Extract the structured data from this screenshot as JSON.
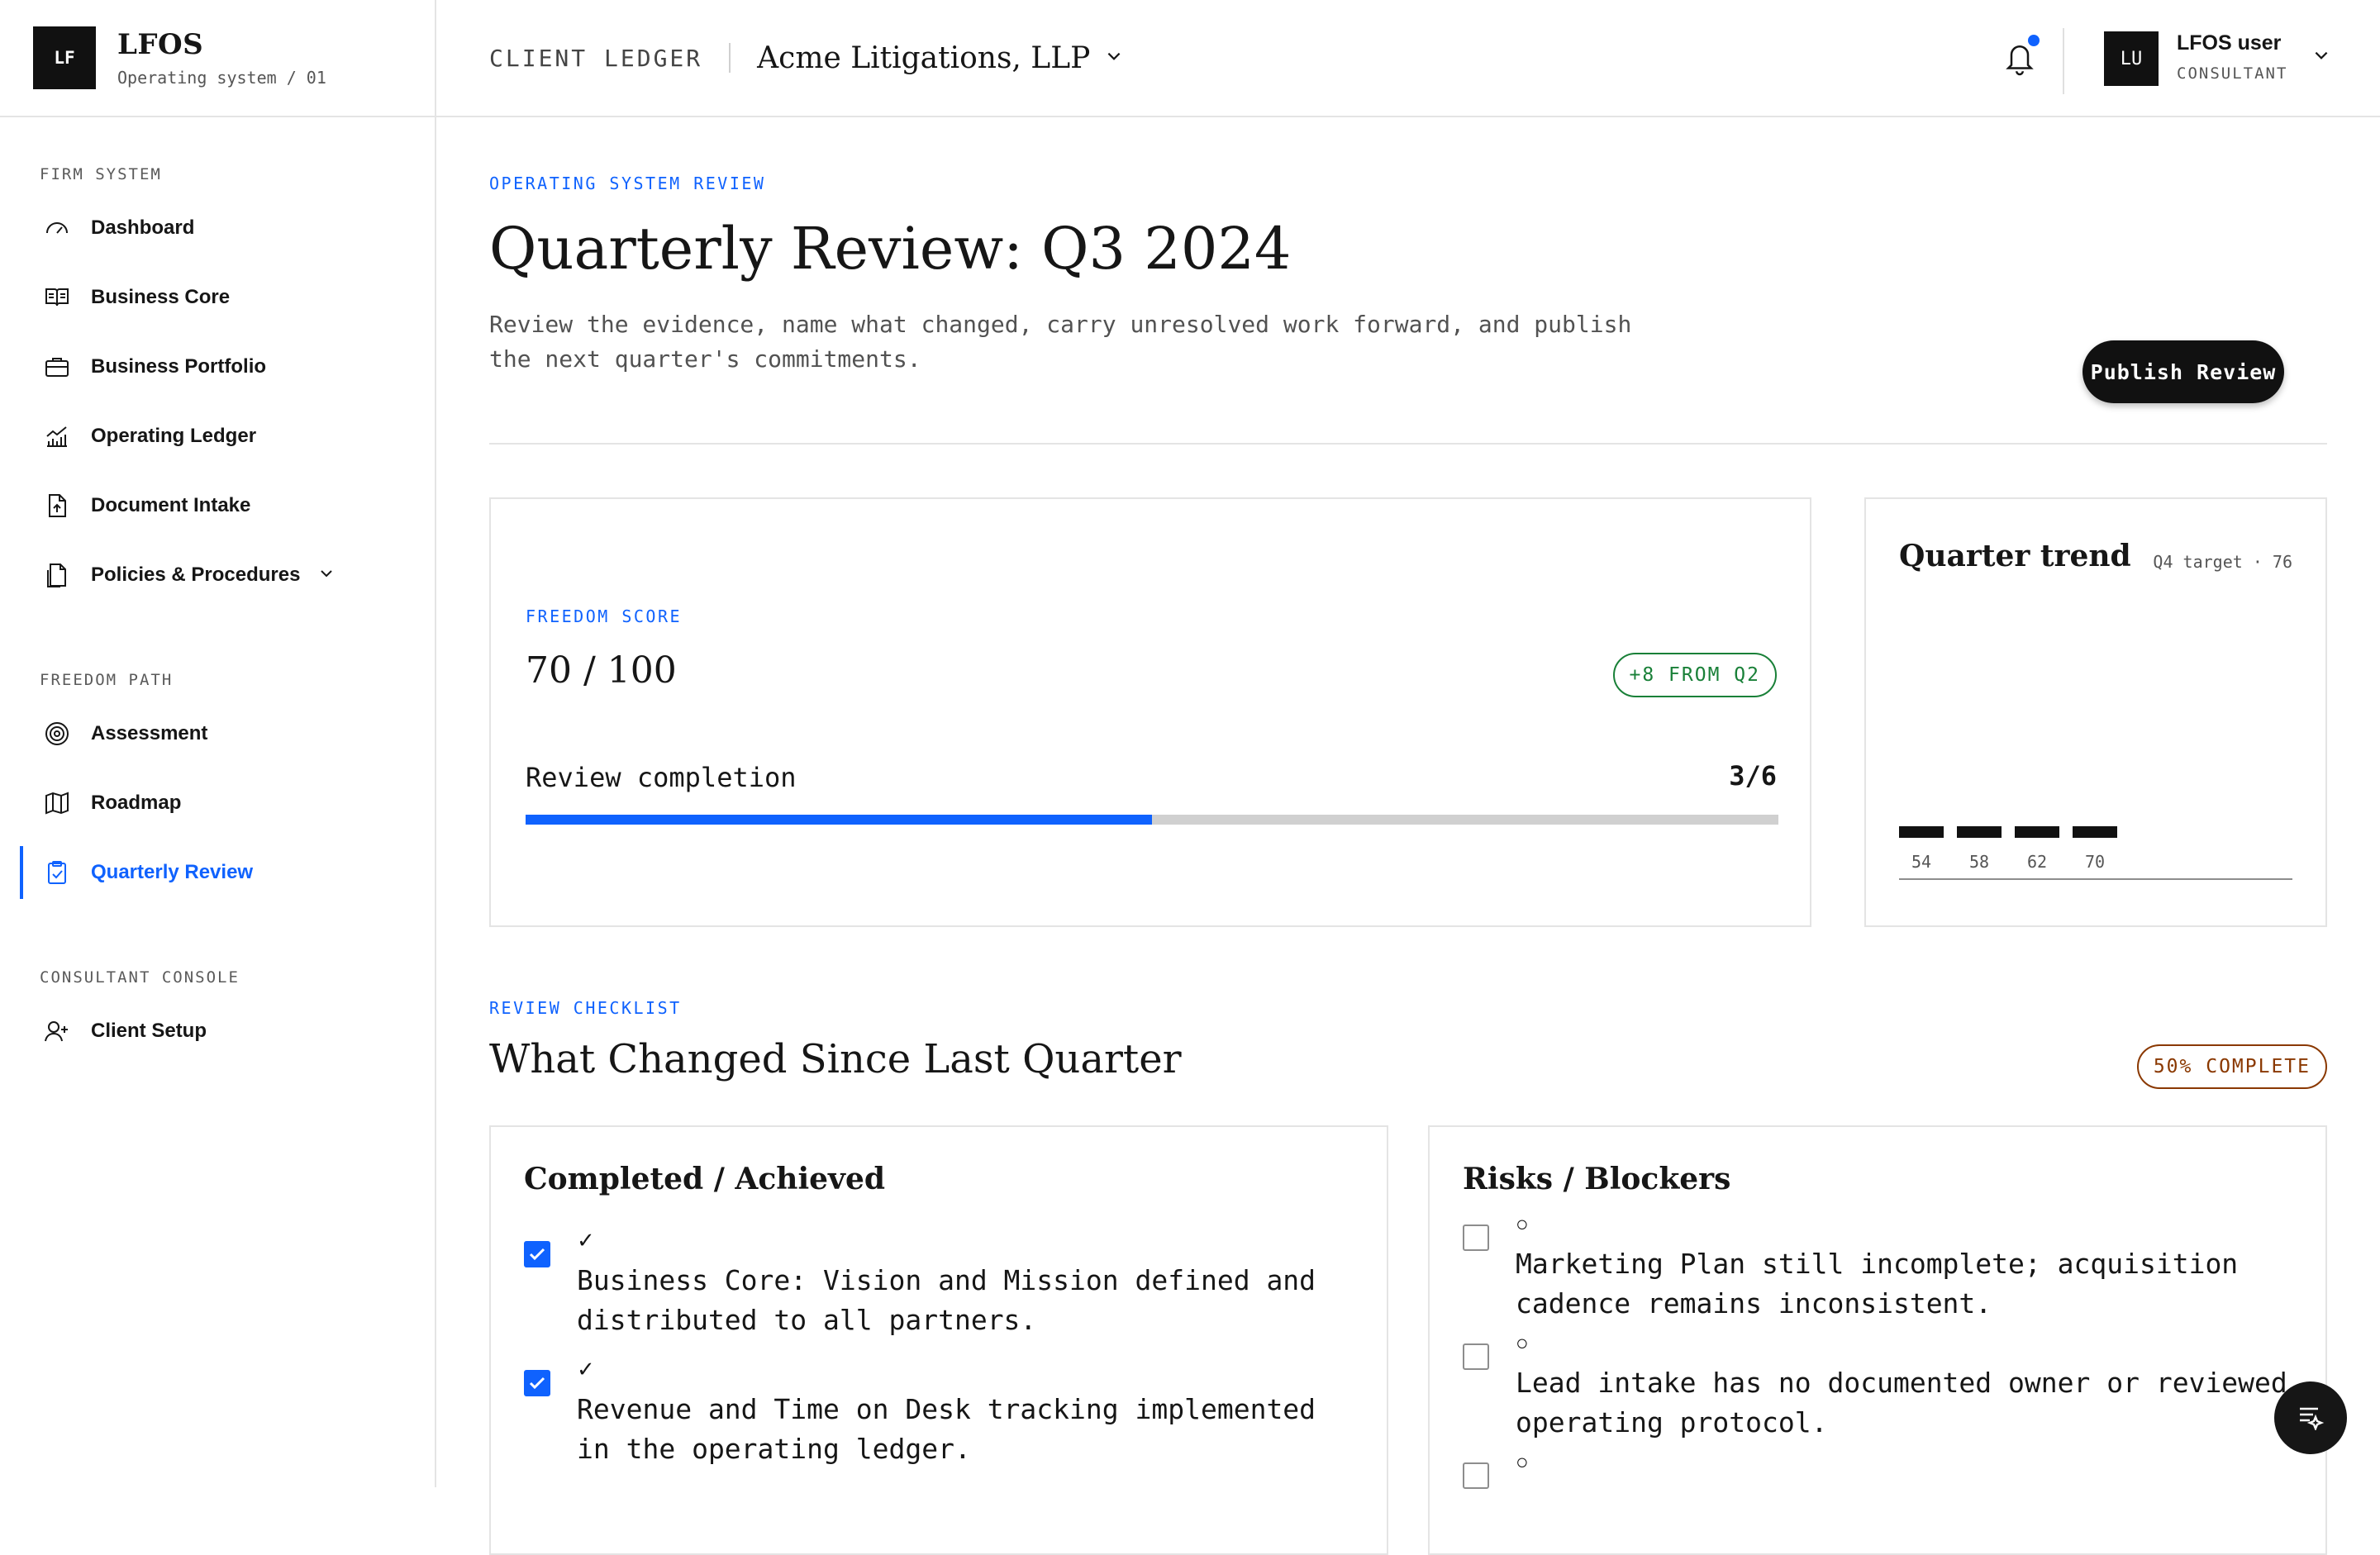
{
  "brand": {
    "mark": "LF",
    "name": "LFOS",
    "subtitle": "Operating system / 01"
  },
  "sidebar": {
    "sections": [
      {
        "title": "FIRM SYSTEM",
        "items": [
          {
            "label": "Dashboard",
            "icon": "gauge-icon"
          },
          {
            "label": "Business Core",
            "icon": "book-icon"
          },
          {
            "label": "Business Portfolio",
            "icon": "briefcase-icon"
          },
          {
            "label": "Operating Ledger",
            "icon": "chart-line-icon"
          },
          {
            "label": "Document Intake",
            "icon": "file-upload-icon"
          },
          {
            "label": "Policies & Procedures",
            "icon": "document-icon"
          }
        ]
      },
      {
        "title": "FREEDOM PATH",
        "items": [
          {
            "label": "Assessment",
            "icon": "target-icon"
          },
          {
            "label": "Roadmap",
            "icon": "map-icon"
          },
          {
            "label": "Quarterly Review",
            "icon": "clipboard-check-icon",
            "active": true
          }
        ]
      },
      {
        "title": "CONSULTANT CONSOLE",
        "items": [
          {
            "label": "Client Setup",
            "icon": "user-add-icon"
          }
        ]
      }
    ]
  },
  "header": {
    "breadcrumb": "CLIENT LEDGER",
    "client_name": "Acme Litigations, LLP",
    "user": {
      "initials": "LU",
      "name": "LFOS user",
      "role": "CONSULTANT"
    }
  },
  "page": {
    "eyebrow": "OPERATING SYSTEM REVIEW",
    "title": "Quarterly Review: Q3 2024",
    "description": "Review the evidence, name what changed, carry unresolved work forward, and publish the next quarter's commitments.",
    "publish_label": "Publish Review"
  },
  "score": {
    "eyebrow": "FREEDOM SCORE",
    "value": "70 / 100",
    "delta": "+8 FROM Q2",
    "completion_label": "Review completion",
    "completion_value": "3/6",
    "completion_fraction": 0.5
  },
  "chart_data": {
    "type": "bar",
    "title": "Quarter trend",
    "annotation": "Q4 target · 76",
    "categories": [
      "54",
      "58",
      "62",
      "70"
    ],
    "values": [
      54,
      58,
      62,
      70
    ]
  },
  "checklist": {
    "eyebrow": "REVIEW CHECKLIST",
    "title": "What Changed Since Last Quarter",
    "progress": "50% COMPLETE",
    "completed": {
      "title": "Completed / Achieved",
      "items": [
        {
          "mark": "✓",
          "text": "Business Core: Vision and Mission defined and distributed to all partners.",
          "checked": true
        },
        {
          "mark": "✓",
          "text": "Revenue and Time on Desk tracking implemented in the operating ledger.",
          "checked": true
        }
      ]
    },
    "risks": {
      "title": "Risks / Blockers",
      "items": [
        {
          "mark": "○",
          "text": "Marketing Plan still incomplete; acquisition cadence remains inconsistent.",
          "checked": false
        },
        {
          "mark": "○",
          "text": "Lead intake has no documented owner or reviewed operating protocol.",
          "checked": false
        },
        {
          "mark": "○",
          "text": "",
          "checked": false
        }
      ]
    }
  },
  "colors": {
    "accent": "#0f62fe",
    "success": "#198038",
    "warning": "#8a3800",
    "ink": "#111111"
  }
}
